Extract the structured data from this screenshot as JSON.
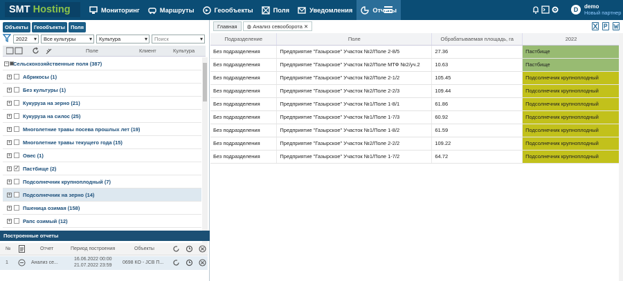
{
  "app": {
    "brand_a": "SMT",
    "brand_b": "Hosting"
  },
  "nav": [
    {
      "label": "Мониторинг",
      "icon": "monitor-icon"
    },
    {
      "label": "Маршруты",
      "icon": "car-icon"
    },
    {
      "label": "Геообъекты",
      "icon": "geo-icon"
    },
    {
      "label": "Поля",
      "icon": "field-icon"
    },
    {
      "label": "Уведомления",
      "icon": "mail-icon"
    },
    {
      "label": "Отчеты",
      "icon": "chart-icon"
    }
  ],
  "user": {
    "initial": "D",
    "name": "demo",
    "role": "Новый партнер"
  },
  "left": {
    "tabs": [
      "Объекты",
      "Геообъекты",
      "Поля"
    ],
    "year": "2022",
    "culture_all": "Все культуры",
    "culture": "Культура",
    "search_placeholder": "Поиск",
    "cols": {
      "field": "Поле",
      "client": "Клиент",
      "culture": "Культура"
    },
    "root": "Сельскохозяйственные поля (387)",
    "items": [
      {
        "label": "Абрикосы (1)",
        "checked": false
      },
      {
        "label": "Без культуры (1)",
        "checked": false
      },
      {
        "label": "Кукуруза на зерно (21)",
        "checked": false
      },
      {
        "label": "Кукуруза на силос (25)",
        "checked": false
      },
      {
        "label": "Многолетние травы посева прошлых лет (19)",
        "checked": false
      },
      {
        "label": "Многолетние травы текущего года (15)",
        "checked": false
      },
      {
        "label": "Овес (1)",
        "checked": false
      },
      {
        "label": "Пастбище (2)",
        "checked": true
      },
      {
        "label": "Подсолнечник крупноплодный (7)",
        "checked": false
      },
      {
        "label": "Подсолнечник на зерно (14)",
        "checked": false
      },
      {
        "label": "Пшеница озимая (158)",
        "checked": false
      },
      {
        "label": "Рапс озимый (12)",
        "checked": false
      }
    ]
  },
  "reports": {
    "title": "Построенные отчеты",
    "cols": {
      "num": "№",
      "report": "Отчет",
      "period": "Период построения",
      "objects": "Объекты"
    },
    "row": {
      "num": "1",
      "name": "Анализ се...",
      "from": "16.06.2022 00:00",
      "to": "21.07.2022 23:59",
      "objects": "0698 КО - JCB П..."
    }
  },
  "content": {
    "tabs": [
      "Главная",
      "Анализ севооборота"
    ],
    "cols": {
      "unit": "Подразделение",
      "field": "Поле",
      "area": "Обрабатываемая площадь, га",
      "year": "2022"
    },
    "rows": [
      {
        "unit": "Без подразделения",
        "field": "Предприятие \"Газырское\" Участок №2/Поле 2-8/5",
        "area": "27.36",
        "crop": "Пастбище",
        "color": "#98bb72"
      },
      {
        "unit": "Без подразделения",
        "field": "Предприятие \"Газырское\" Участок №2/Поле МТФ №2/уч.2",
        "area": "10.63",
        "crop": "Пастбище",
        "color": "#98bb72"
      },
      {
        "unit": "Без подразделения",
        "field": "Предприятие \"Газырское\" Участок №2/Поле 2-1/2",
        "area": "105.45",
        "crop": "Подсолнечник крупноплодный",
        "color": "#c2c11b"
      },
      {
        "unit": "Без подразделения",
        "field": "Предприятие \"Газырское\" Участок №2/Поле 2-2/3",
        "area": "109.44",
        "crop": "Подсолнечник крупноплодный",
        "color": "#c2c11b"
      },
      {
        "unit": "Без подразделения",
        "field": "Предприятие \"Газырское\" Участок №1/Поле 1-8/1",
        "area": "61.86",
        "crop": "Подсолнечник крупноплодный",
        "color": "#c2c11b"
      },
      {
        "unit": "Без подразделения",
        "field": "Предприятие \"Газырское\" Участок №1/Поле 1-7/3",
        "area": "60.92",
        "crop": "Подсолнечник крупноплодный",
        "color": "#c2c11b"
      },
      {
        "unit": "Без подразделения",
        "field": "Предприятие \"Газырское\" Участок №1/Поле 1-8/2",
        "area": "61.59",
        "crop": "Подсолнечник крупноплодный",
        "color": "#c2c11b"
      },
      {
        "unit": "Без подразделения",
        "field": "Предприятие \"Газырское\" Участок №2/Поле 2-2/2",
        "area": "109.22",
        "crop": "Подсолнечник крупноплодный",
        "color": "#c2c11b"
      },
      {
        "unit": "Без подразделения",
        "field": "Предприятие \"Газырское\" Участок №1/Поле 1-7/2",
        "area": "64.72",
        "crop": "Подсолнечник крупноплодный",
        "color": "#c2c11b"
      }
    ]
  }
}
